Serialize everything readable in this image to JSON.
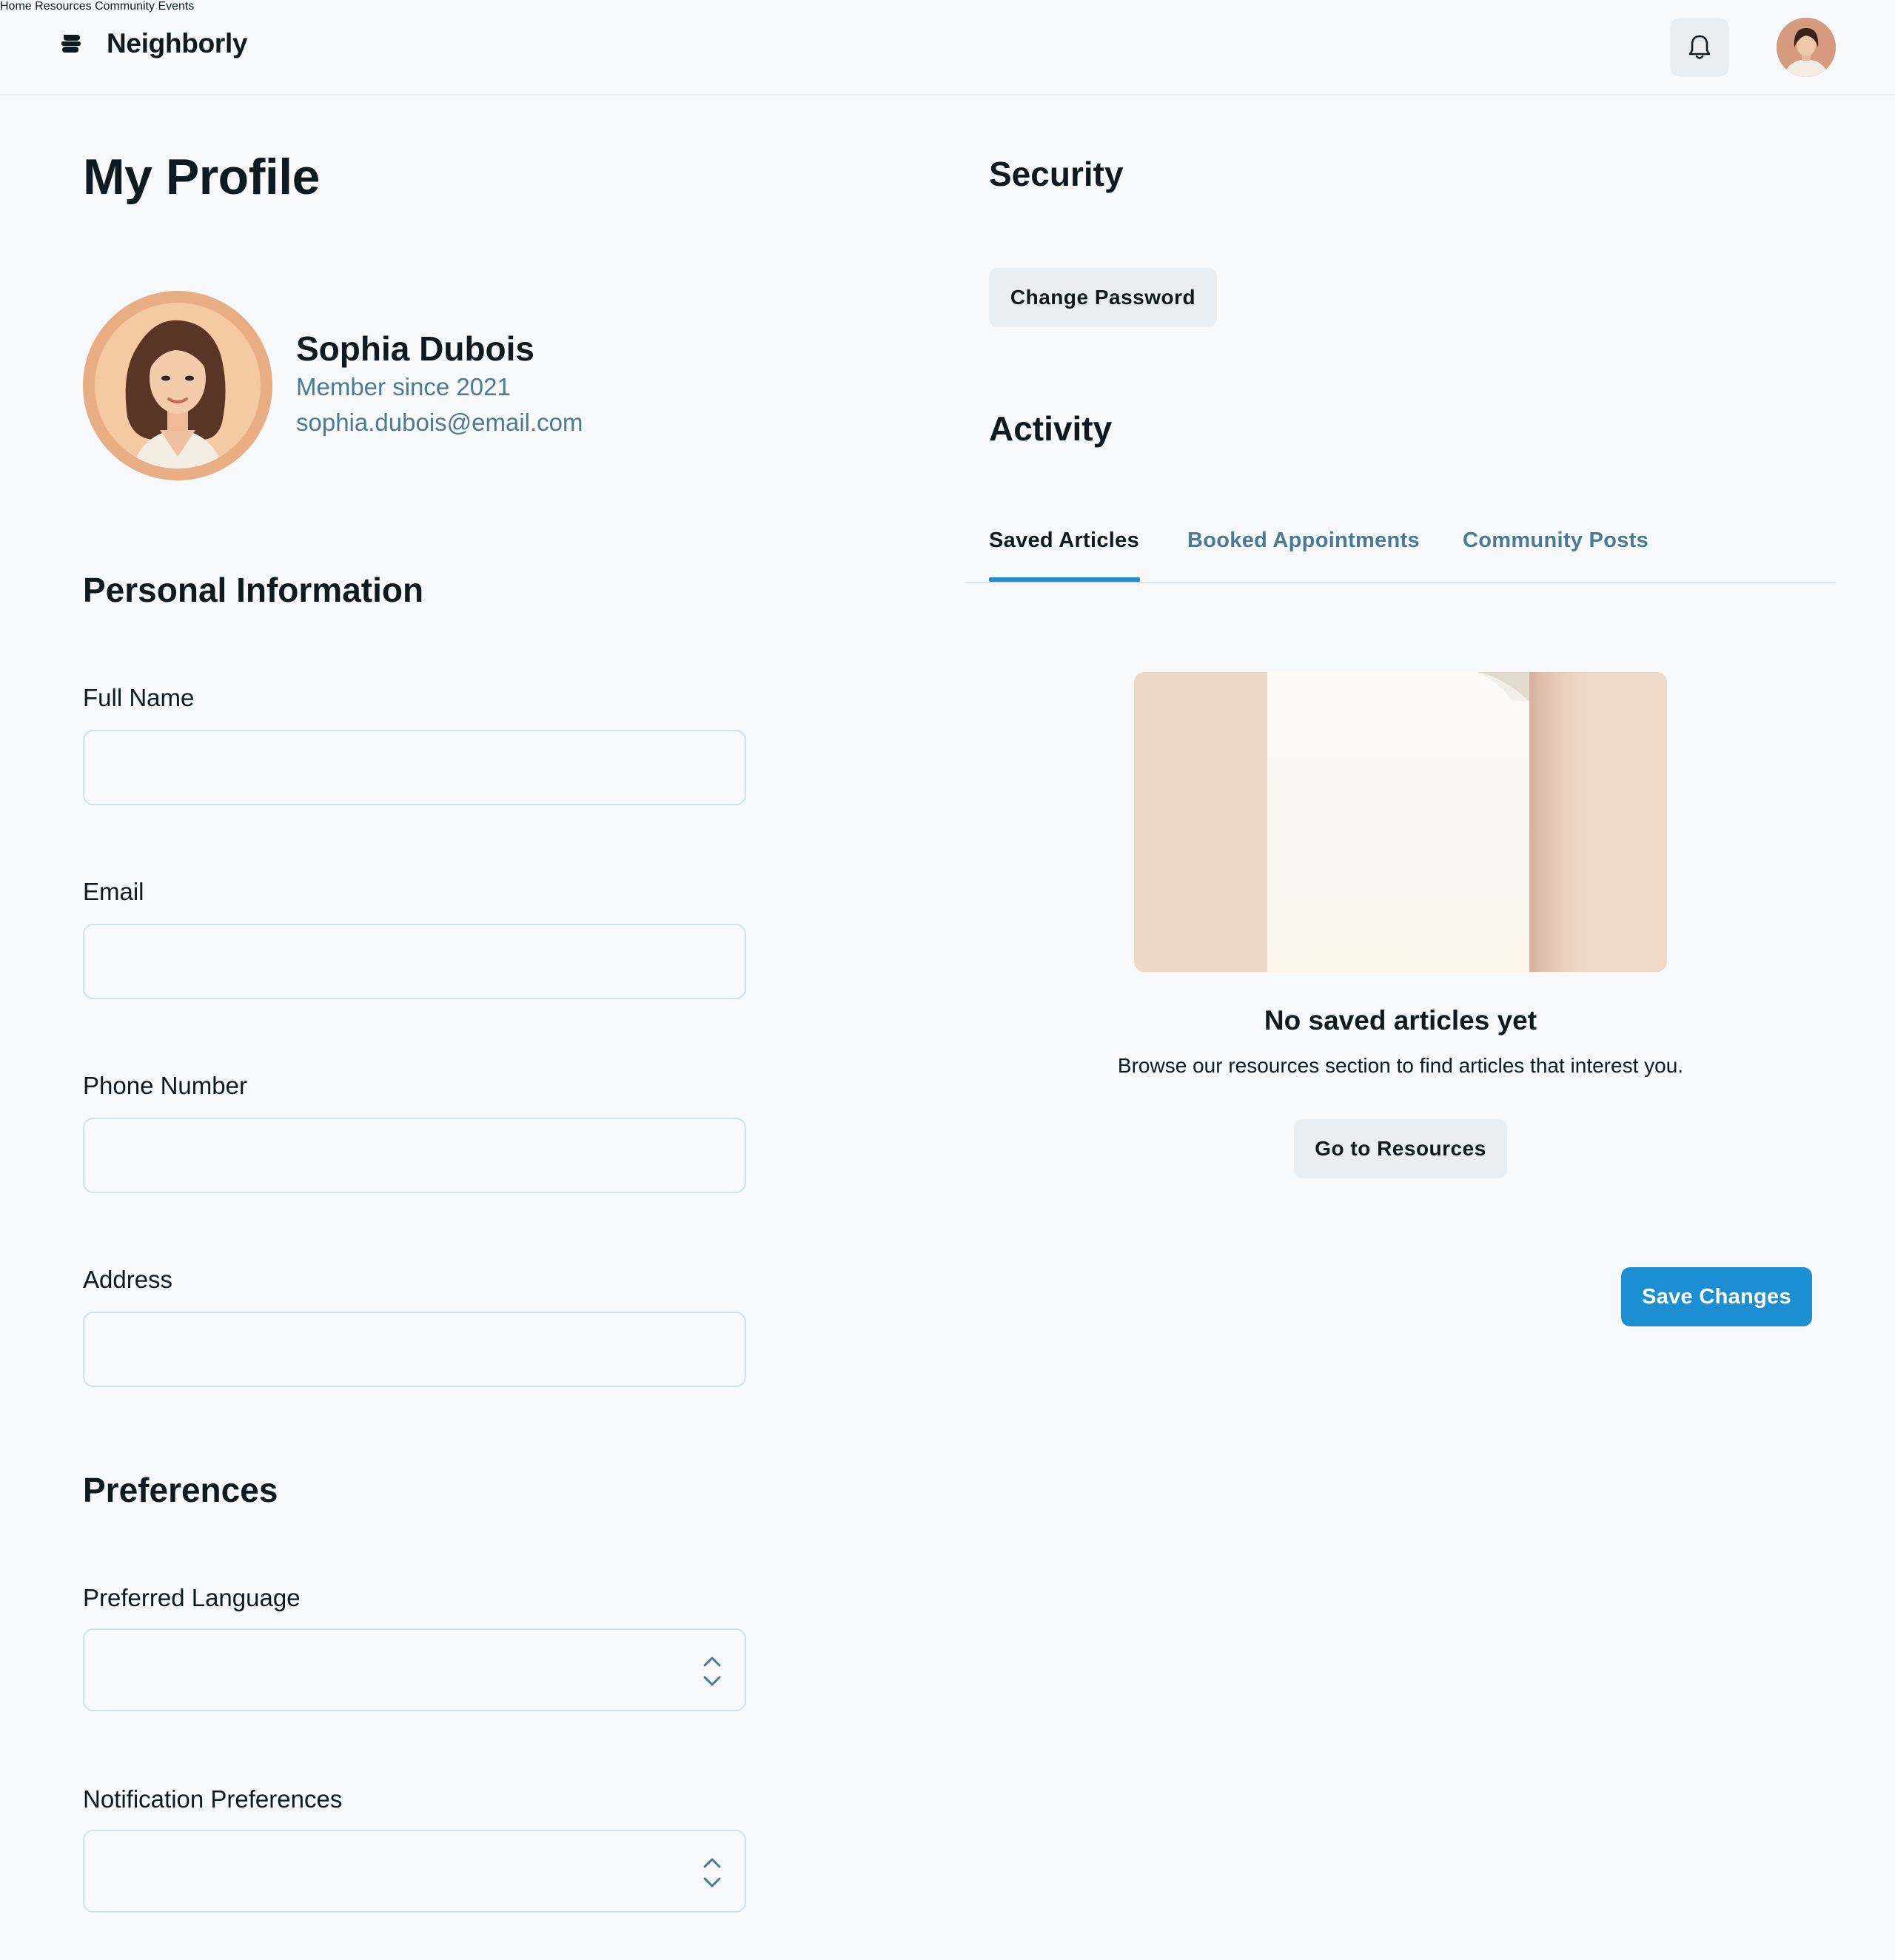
{
  "header": {
    "brand_name": "Neighborly",
    "nav": [
      "Home",
      "Resources",
      "Community",
      "Events"
    ]
  },
  "profile": {
    "page_title": "My Profile",
    "name": "Sophia Dubois",
    "member_since": "Member since 2021",
    "email": "sophia.dubois@email.com"
  },
  "personal_info": {
    "title": "Personal Information",
    "fields": [
      {
        "label": "Full Name",
        "value": ""
      },
      {
        "label": "Email",
        "value": ""
      },
      {
        "label": "Phone Number",
        "value": ""
      },
      {
        "label": "Address",
        "value": ""
      }
    ]
  },
  "preferences": {
    "title": "Preferences",
    "selects": [
      {
        "label": "Preferred Language",
        "value": ""
      },
      {
        "label": "Notification Preferences",
        "value": ""
      }
    ]
  },
  "security": {
    "title": "Security",
    "change_password": "Change Password"
  },
  "activity": {
    "title": "Activity",
    "tabs": [
      "Saved Articles",
      "Booked Appointments",
      "Community Posts"
    ],
    "active_tab": 0,
    "empty_title": "No saved articles yet",
    "empty_desc": "Browse our resources section to find articles that interest you.",
    "empty_button": "Go to Resources"
  },
  "actions": {
    "save": "Save Changes"
  },
  "colors": {
    "accent": "#1c8fd3",
    "muted_text": "#4a7a96",
    "page_bg": "#f7f9fb"
  },
  "icons": [
    "neighborly-logo-icon",
    "bell-icon",
    "chevron-up-down-icon"
  ]
}
